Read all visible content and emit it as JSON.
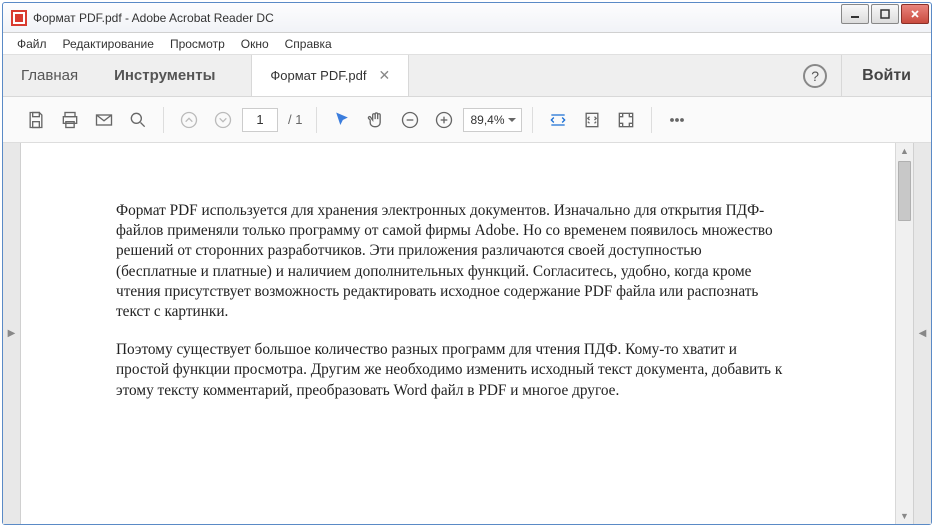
{
  "window": {
    "title": "Формат PDF.pdf - Adobe Acrobat Reader DC"
  },
  "menubar": [
    "Файл",
    "Редактирование",
    "Просмотр",
    "Окно",
    "Справка"
  ],
  "tabs": {
    "home": "Главная",
    "tools": "Инструменты",
    "doc": "Формат PDF.pdf",
    "signin": "Войти"
  },
  "toolbar": {
    "page_current": "1",
    "page_total": "/ 1",
    "zoom": "89,4%"
  },
  "document": {
    "para1": "Формат PDF используется для хранения электронных документов. Изначально для открытия ПДФ-файлов применяли только программу от самой фирмы Adobe. Но со временем появилось множество решений от сторонних разработчиков. Эти приложения различаются своей доступностью (бесплатные и платные) и наличием дополнительных функций. Согласитесь, удобно, когда кроме чтения присутствует возможность редактировать исходное содержание PDF файла или распознать текст с картинки.",
    "para2": "Поэтому существует большое количество разных программ для чтения ПДФ. Кому-то хватит и простой функции просмотра. Другим же необходимо изменить исходный текст документа, добавить к этому тексту комментарий, преобразовать Word файл в PDF и многое другое."
  }
}
